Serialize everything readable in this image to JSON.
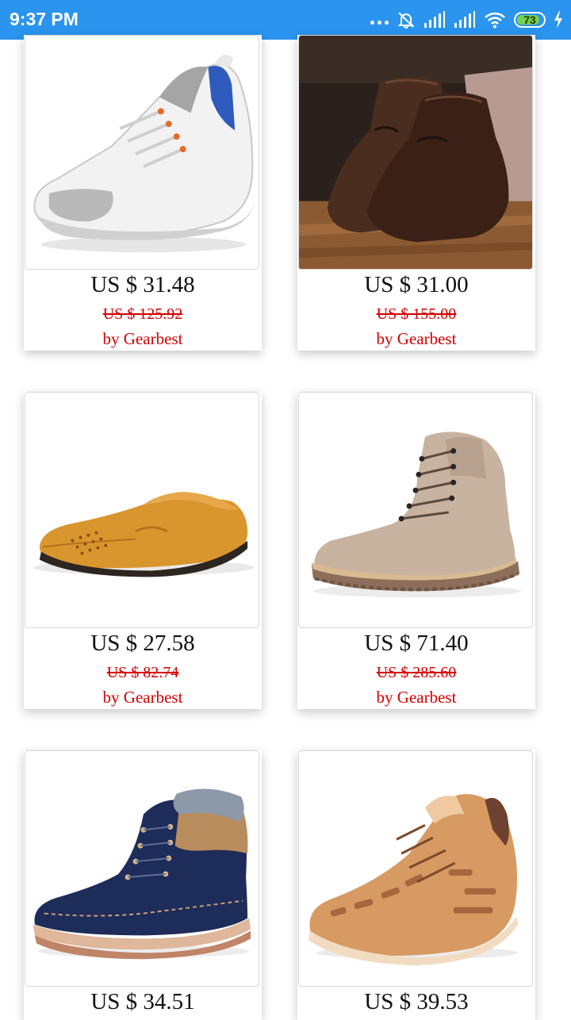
{
  "status_bar": {
    "time": "9:37 PM",
    "battery": "73"
  },
  "products": [
    {
      "price": "US $ 31.48",
      "old_price": "US $ 125.92",
      "seller": "by Gearbest",
      "image": "white-sneaker"
    },
    {
      "price": "US $ 31.00",
      "old_price": "US $ 155.00",
      "seller": "by Gearbest",
      "image": "brown-leather-shoes"
    },
    {
      "price": "US $ 27.58",
      "old_price": "US $ 82.74",
      "seller": "by Gearbest",
      "image": "tan-loafer"
    },
    {
      "price": "US $ 71.40",
      "old_price": "US $ 285.60",
      "seller": "by Gearbest",
      "image": "beige-boot"
    },
    {
      "price": "US $ 34.51",
      "image": "navy-winter-boot"
    },
    {
      "price": "US $ 39.53",
      "image": "orange-knit-sneaker"
    }
  ],
  "colors": {
    "status_bar": "#2a94ee",
    "sale_red": "#d40000",
    "battery_green": "#76d14b"
  }
}
